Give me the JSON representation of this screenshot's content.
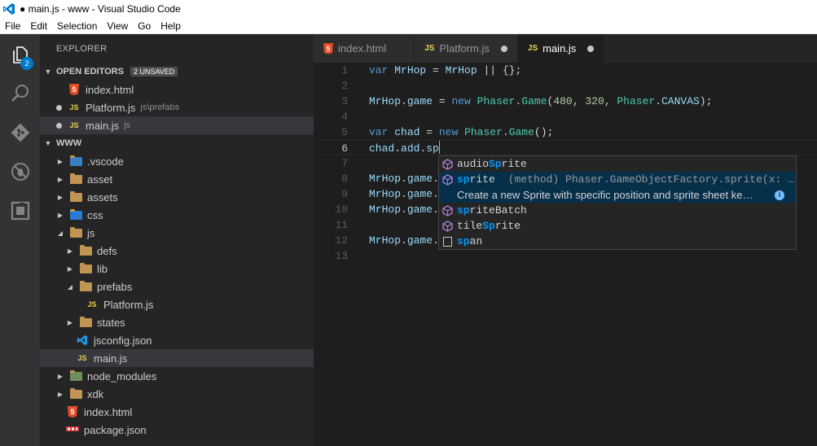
{
  "window": {
    "title": "● main.js - www - Visual Studio Code"
  },
  "menu": [
    "File",
    "Edit",
    "Selection",
    "View",
    "Go",
    "Help"
  ],
  "activity": {
    "explorer_badge": "2"
  },
  "sidebar": {
    "title": "EXPLORER",
    "open_editors": {
      "header": "OPEN EDITORS",
      "badge": "2 UNSAVED",
      "items": [
        {
          "icon": "html5-icon",
          "label": "index.html",
          "desc": "",
          "dirty": false
        },
        {
          "icon": "js-icon",
          "label": "Platform.js",
          "desc": "js\\prefabs",
          "dirty": true
        },
        {
          "icon": "js-icon",
          "label": "main.js",
          "desc": "js",
          "dirty": true
        }
      ]
    },
    "workspace": {
      "header": "WWW",
      "items": [
        {
          "label": ".vscode",
          "icon": "vscode-folder-icon",
          "depth": 0,
          "twisty": "closed"
        },
        {
          "label": "asset",
          "icon": "folder-icon",
          "depth": 0,
          "twisty": "closed"
        },
        {
          "label": "assets",
          "icon": "folder-icon",
          "depth": 0,
          "twisty": "closed"
        },
        {
          "label": "css",
          "icon": "css-folder-icon",
          "depth": 0,
          "twisty": "closed"
        },
        {
          "label": "js",
          "icon": "folder-open-icon",
          "depth": 0,
          "twisty": "open"
        },
        {
          "label": "defs",
          "icon": "folder-icon",
          "depth": 1,
          "twisty": "closed"
        },
        {
          "label": "lib",
          "icon": "folder-icon",
          "depth": 1,
          "twisty": "closed"
        },
        {
          "label": "prefabs",
          "icon": "folder-open-icon",
          "depth": 1,
          "twisty": "open"
        },
        {
          "label": "Platform.js",
          "icon": "js-icon",
          "depth": 2,
          "twisty": "none"
        },
        {
          "label": "states",
          "icon": "folder-icon",
          "depth": 1,
          "twisty": "closed"
        },
        {
          "label": "jsconfig.json",
          "icon": "vscode-icon",
          "depth": 1,
          "twisty": "none"
        },
        {
          "label": "main.js",
          "icon": "js-icon",
          "depth": 1,
          "twisty": "none",
          "active": true
        },
        {
          "label": "node_modules",
          "icon": "node-folder-icon",
          "depth": 0,
          "twisty": "closed"
        },
        {
          "label": "xdk",
          "icon": "folder-icon",
          "depth": 0,
          "twisty": "closed"
        },
        {
          "label": "index.html",
          "icon": "html5-icon",
          "depth": 0,
          "twisty": "none"
        },
        {
          "label": "package.json",
          "icon": "npm-icon",
          "depth": 0,
          "twisty": "none"
        }
      ]
    }
  },
  "tabs": [
    {
      "label": "index.html",
      "icon": "html5-icon",
      "active": false,
      "dirty": false
    },
    {
      "label": "Platform.js",
      "icon": "js-icon",
      "active": false,
      "dirty": true
    },
    {
      "label": "main.js",
      "icon": "js-icon",
      "active": true,
      "dirty": true
    }
  ],
  "editor": {
    "current_line": 6,
    "lines": [
      {
        "n": "1",
        "tokens": [
          [
            "k",
            "var"
          ],
          [
            "p",
            " "
          ],
          [
            "v",
            "MrHop"
          ],
          [
            "p",
            " = "
          ],
          [
            "v",
            "MrHop"
          ],
          [
            "p",
            " || {};"
          ]
        ]
      },
      {
        "n": "2",
        "tokens": []
      },
      {
        "n": "3",
        "tokens": [
          [
            "v",
            "MrHop"
          ],
          [
            "p",
            "."
          ],
          [
            "v",
            "game"
          ],
          [
            "p",
            " = "
          ],
          [
            "k",
            "new"
          ],
          [
            "p",
            " "
          ],
          [
            "t",
            "Phaser"
          ],
          [
            "p",
            "."
          ],
          [
            "t",
            "Game"
          ],
          [
            "p",
            "("
          ],
          [
            "n",
            "480"
          ],
          [
            "p",
            ", "
          ],
          [
            "n",
            "320"
          ],
          [
            "p",
            ", "
          ],
          [
            "t",
            "Phaser"
          ],
          [
            "p",
            "."
          ],
          [
            "v",
            "CANVAS"
          ],
          [
            "p",
            ");"
          ]
        ]
      },
      {
        "n": "4",
        "tokens": []
      },
      {
        "n": "5",
        "tokens": [
          [
            "k",
            "var"
          ],
          [
            "p",
            " "
          ],
          [
            "v",
            "chad"
          ],
          [
            "p",
            " = "
          ],
          [
            "k",
            "new"
          ],
          [
            "p",
            " "
          ],
          [
            "t",
            "Phaser"
          ],
          [
            "p",
            "."
          ],
          [
            "t",
            "Game"
          ],
          [
            "p",
            "();"
          ]
        ]
      },
      {
        "n": "6",
        "tokens": [
          [
            "v",
            "chad"
          ],
          [
            "p",
            "."
          ],
          [
            "v",
            "add"
          ],
          [
            "p",
            "."
          ],
          [
            "v",
            "sp"
          ]
        ]
      },
      {
        "n": "7",
        "tokens": []
      },
      {
        "n": "8",
        "tokens": [
          [
            "v",
            "MrHop"
          ],
          [
            "p",
            "."
          ],
          [
            "v",
            "game"
          ],
          [
            "p",
            "."
          ]
        ]
      },
      {
        "n": "9",
        "tokens": [
          [
            "v",
            "MrHop"
          ],
          [
            "p",
            "."
          ],
          [
            "v",
            "game"
          ],
          [
            "p",
            "."
          ]
        ]
      },
      {
        "n": "10",
        "tokens": [
          [
            "v",
            "MrHop"
          ],
          [
            "p",
            "."
          ],
          [
            "v",
            "game"
          ],
          [
            "p",
            "."
          ]
        ]
      },
      {
        "n": "11",
        "tokens": []
      },
      {
        "n": "12",
        "tokens": [
          [
            "v",
            "MrHop"
          ],
          [
            "p",
            "."
          ],
          [
            "v",
            "game"
          ],
          [
            "p",
            "."
          ]
        ]
      },
      {
        "n": "13",
        "tokens": []
      }
    ]
  },
  "suggest": {
    "items": [
      {
        "icon": "method-icon",
        "pre": "audio",
        "hl": "Sp",
        "post": "rite",
        "detail": "",
        "focused": false
      },
      {
        "icon": "method-icon",
        "pre": "",
        "hl": "sp",
        "post": "rite",
        "detail": "(method) Phaser.GameObjectFactory.sprite(x: …",
        "focused": true
      },
      {
        "icon": "method-icon",
        "pre": "",
        "hl": "sp",
        "post": "riteBatch",
        "detail": "",
        "focused": false
      },
      {
        "icon": "method-icon",
        "pre": "tile",
        "hl": "Sp",
        "post": "rite",
        "detail": "",
        "focused": false
      },
      {
        "icon": "snippet-icon",
        "pre": "",
        "hl": "sp",
        "post": "an",
        "detail": "",
        "focused": false
      }
    ],
    "doc": "Create a new Sprite with specific position and sprite sheet ke…"
  }
}
